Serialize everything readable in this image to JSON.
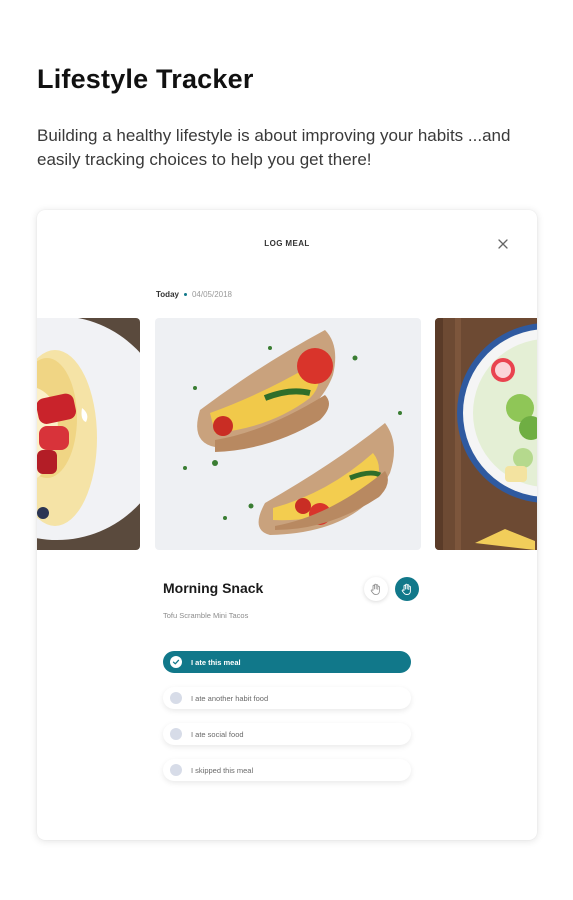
{
  "page": {
    "headline": "Lifestyle Tracker",
    "description": "Building a healthy lifestyle is about improving your habits ...and easily tracking choices to help you get there!"
  },
  "card": {
    "title": "LOG MEAL",
    "date_label": "Today",
    "date_value": "04/05/2018",
    "meal_title": "Morning Snack",
    "meal_subtitle": "Tofu Scramble Mini Tacos",
    "options": [
      {
        "label": "I ate this meal",
        "selected": true
      },
      {
        "label": "I ate another habit food",
        "selected": false
      },
      {
        "label": "I ate social food",
        "selected": false
      },
      {
        "label": "I skipped this meal",
        "selected": false
      }
    ]
  },
  "colors": {
    "accent": "#11788a",
    "radio_unselected": "#d7dce8"
  }
}
